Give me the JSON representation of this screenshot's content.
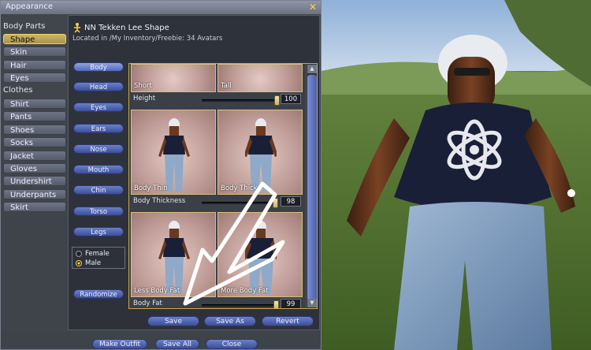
{
  "window": {
    "title": "Appearance"
  },
  "sidebar": {
    "body_parts_header": "Body Parts",
    "body_parts": [
      "Shape",
      "Skin",
      "Hair",
      "Eyes"
    ],
    "clothes_header": "Clothes",
    "clothes": [
      "Shirt",
      "Pants",
      "Shoes",
      "Socks",
      "Jacket",
      "Gloves",
      "Undershirt",
      "Underpants",
      "Skirt"
    ],
    "selected": "Shape"
  },
  "item": {
    "name": "NN Tekken Lee Shape",
    "location": "Located in /My Inventory/Freebie: 34 Avatars"
  },
  "categories": [
    "Body",
    "Head",
    "Eyes",
    "Ears",
    "Nose",
    "Mouth",
    "Chin",
    "Torso",
    "Legs"
  ],
  "active_category": "Body",
  "sex": {
    "female": "Female",
    "male": "Male",
    "selected": "Male"
  },
  "randomize_label": "Randomize",
  "params": [
    {
      "low_label": "Short",
      "high_label": "Tall",
      "name": "Height",
      "value": "100",
      "fraction": 0.99
    },
    {
      "low_label": "Body Thin",
      "high_label": "Body Thick",
      "name": "Body Thickness",
      "value": "98",
      "fraction": 0.97
    },
    {
      "low_label": "Less Body Fat",
      "high_label": "More Body Fat",
      "name": "Body Fat",
      "value": "99",
      "fraction": 0.98
    }
  ],
  "actions": {
    "save": "Save",
    "save_as": "Save As",
    "revert": "Revert"
  },
  "footer": {
    "make_outfit": "Make Outfit",
    "save_all": "Save All",
    "close": "Close"
  },
  "colors": {
    "accent": "#ffd24a",
    "button": "#4a5fa8",
    "selected_item": "#c9b56a"
  },
  "icons": {
    "close": "close-icon",
    "shape": "shape-icon"
  }
}
